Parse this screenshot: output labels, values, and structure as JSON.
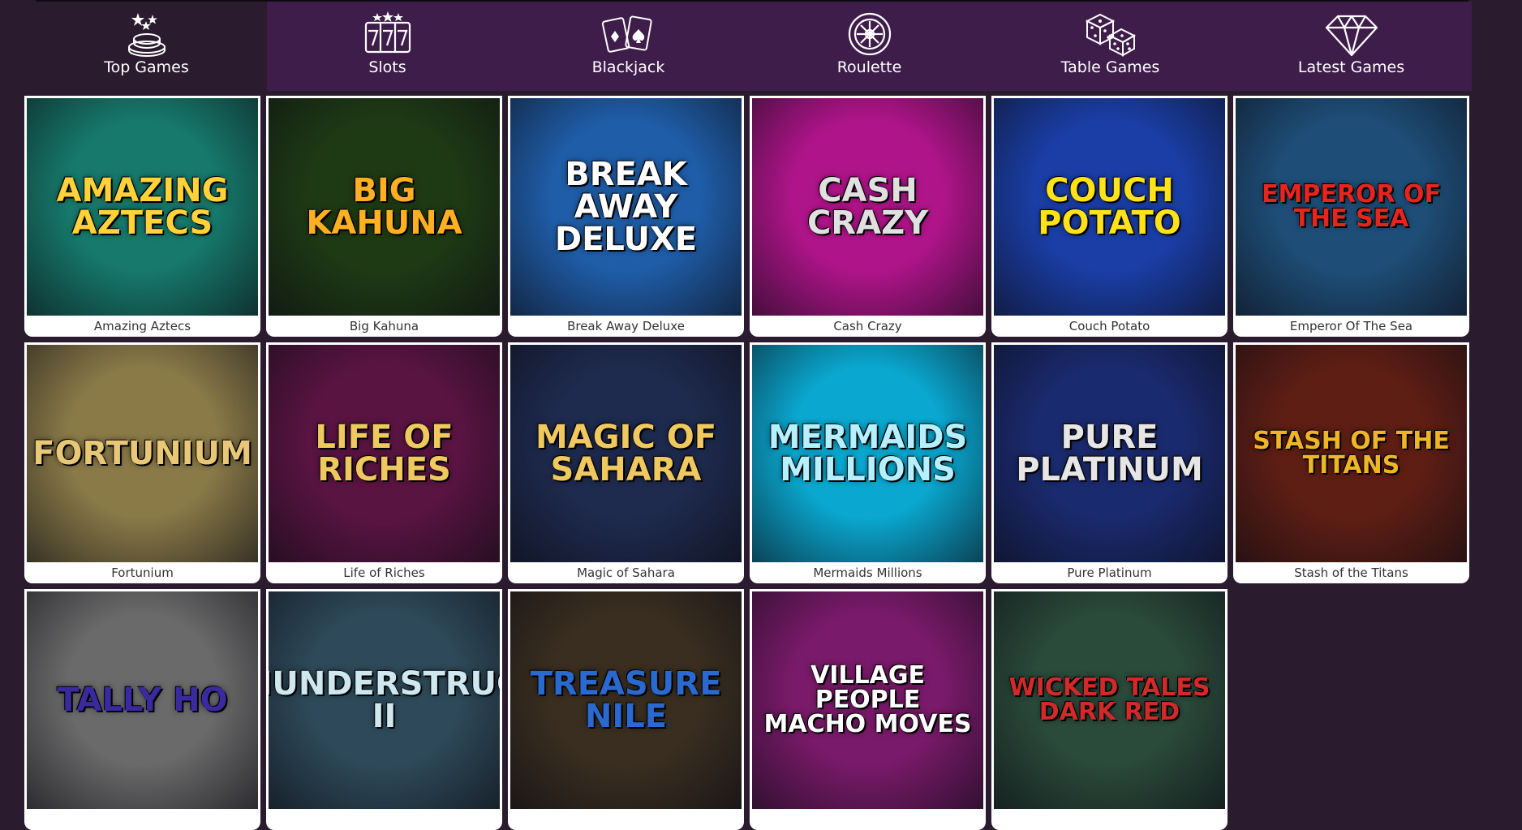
{
  "nav": [
    {
      "label": "Top Games",
      "icon": "poker-chips-stars-icon"
    },
    {
      "label": "Slots",
      "icon": "slot-777-icon"
    },
    {
      "label": "Blackjack",
      "icon": "playing-cards-icon"
    },
    {
      "label": "Roulette",
      "icon": "roulette-wheel-icon"
    },
    {
      "label": "Table Games",
      "icon": "dice-icon"
    },
    {
      "label": "Latest Games",
      "icon": "diamond-icon"
    }
  ],
  "games": [
    {
      "name": "Amazing Aztecs",
      "thumb_text": "AMAZING AZTECS",
      "bg": "#16796b",
      "fg": "#ffd23a"
    },
    {
      "name": "Big Kahuna",
      "thumb_text": "BIG KAHUNA",
      "bg": "#1e3a14",
      "fg": "#ffb020"
    },
    {
      "name": "Break Away Deluxe",
      "thumb_text": "BREAK AWAY DELUXE",
      "bg": "#1f5da8",
      "fg": "#ffffff"
    },
    {
      "name": "Cash Crazy",
      "thumb_text": "CASH CRAZY",
      "bg": "#b0148a",
      "fg": "#e0e0e0"
    },
    {
      "name": "Couch Potato",
      "thumb_text": "COUCH POTATO",
      "bg": "#1a3ea6",
      "fg": "#ffe21a"
    },
    {
      "name": "Emperor Of The Sea",
      "thumb_text": "EMPEROR OF THE SEA",
      "bg": "#1e4e78",
      "fg": "#e5251e"
    },
    {
      "name": "Fortunium",
      "thumb_text": "FORTUNIUM",
      "bg": "#8a7a48",
      "fg": "#e8c878"
    },
    {
      "name": "Life of Riches",
      "thumb_text": "LIFE OF RICHES",
      "bg": "#5a1442",
      "fg": "#f0c860"
    },
    {
      "name": "Magic of Sahara",
      "thumb_text": "MAGIC OF SAHARA",
      "bg": "#1e2a4e",
      "fg": "#f0c860"
    },
    {
      "name": "Mermaids Millions",
      "thumb_text": "MERMAIDS MILLIONS",
      "bg": "#0aa8d0",
      "fg": "#b4f0ff"
    },
    {
      "name": "Pure Platinum",
      "thumb_text": "PURE PLATINUM",
      "bg": "#1a2a6e",
      "fg": "#e6e6e6"
    },
    {
      "name": "Stash of the Titans",
      "thumb_text": "STASH OF THE TITANS",
      "bg": "#5e1e14",
      "fg": "#f0b428"
    },
    {
      "name": "",
      "thumb_text": "TALLY HO",
      "bg": "#6a6a6a",
      "fg": "#3a2aa0"
    },
    {
      "name": "",
      "thumb_text": "THUNDERSTRUCK II",
      "bg": "#2e4a5a",
      "fg": "#cfe8f0"
    },
    {
      "name": "",
      "thumb_text": "TREASURE NILE",
      "bg": "#3a2e20",
      "fg": "#2a6ad0"
    },
    {
      "name": "",
      "thumb_text": "VILLAGE PEOPLE MACHO MOVES",
      "bg": "#7a1a6a",
      "fg": "#ffffff"
    },
    {
      "name": "",
      "thumb_text": "WICKED TALES DARK RED",
      "bg": "#2a4a3a",
      "fg": "#d02a2a"
    }
  ],
  "colors": {
    "page_bg": "#2a1c2e",
    "nav_bg": "#3e1d4a",
    "card_bg": "#ffffff"
  }
}
